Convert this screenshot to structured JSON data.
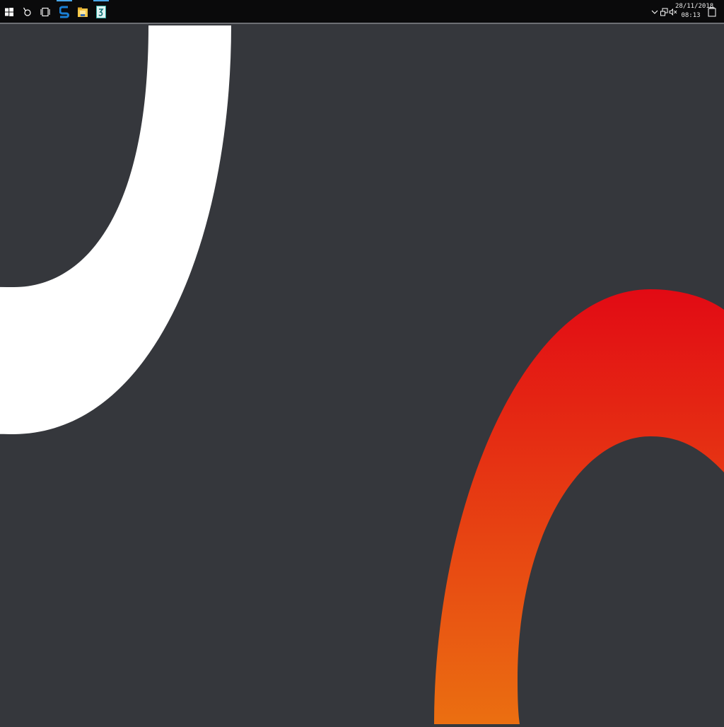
{
  "taskbar": {
    "apps": [
      {
        "icon": "windows-start-icon"
      },
      {
        "icon": "search-icon"
      },
      {
        "icon": "task-view-icon"
      },
      {
        "icon": "browser-icon"
      },
      {
        "icon": "file-explorer-icon"
      },
      {
        "icon": "notes-app-icon"
      }
    ],
    "tray": {
      "chevron_icon": "chevron-down-icon",
      "network_icon": "network-icon",
      "volume_icon": "volume-muted-icon",
      "date": "28/11/2018",
      "time": "08:13",
      "notification_icon": "notification-icon"
    }
  },
  "wallpaper": {
    "background_color": "#35373c",
    "white_arc_color": "#ffffff",
    "red_arc_top_color": "#e20a14",
    "red_arc_bottom_color": "#eb6f11"
  }
}
